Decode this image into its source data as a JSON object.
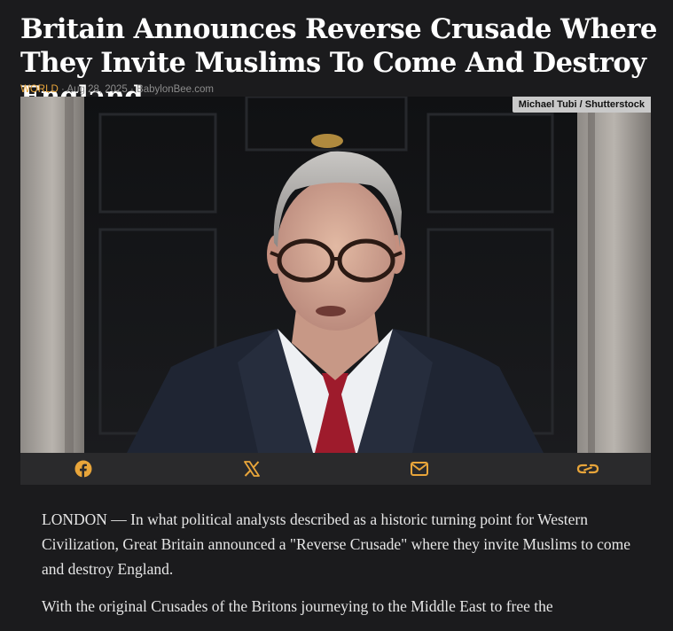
{
  "article": {
    "headline": "Britain Announces Reverse Crusade Where They Invite Muslims To Come And Destroy England",
    "category": "WORLD",
    "separator": " · ",
    "date": "Aug 28, 2025",
    "source": "BabylonBee.com",
    "photo_credit": "Michael Tubi / Shutterstock",
    "paragraphs": [
      "LONDON — In what political analysts described as a historic turning point for Western Civilization, Great Britain announced a \"Reverse Crusade\" where they invite Muslims to come and destroy England.",
      "With the original Crusades of the Britons journeying to the Middle East to free the"
    ]
  },
  "share": {
    "buttons": [
      {
        "icon": "facebook-icon"
      },
      {
        "icon": "x-icon"
      },
      {
        "icon": "email-icon"
      },
      {
        "icon": "link-icon"
      }
    ],
    "accent": "#e8a53a"
  },
  "colors": {
    "background": "#1b1b1d",
    "share_bar": "#2a2a2c",
    "category": "#e8a53a"
  }
}
